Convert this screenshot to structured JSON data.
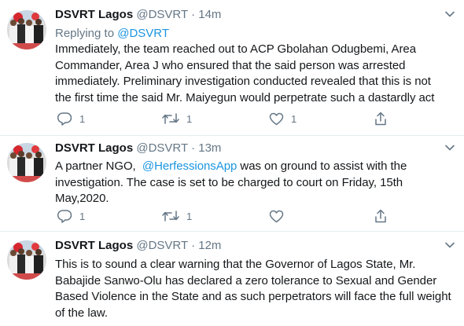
{
  "tweets": [
    {
      "name": "DSVRT Lagos",
      "handle": "@DSVRT",
      "separator": "·",
      "time": "14m",
      "replying_label": "Replying to",
      "replying_handle": "@DSVRT",
      "lines": [
        "Immediately, the team reached out to ACP Gbolahan  Odugbemi, Area",
        "Commander, Area J who ensured that the said person was arrested",
        "immediately. Preliminary investigation conducted revealed  that this is not",
        "the first time the said Mr. Maiyegun would perpetrate such a dastardly act"
      ],
      "reply_count": "1",
      "retweet_count": "1",
      "like_count": "1"
    },
    {
      "name": "DSVRT Lagos",
      "handle": "@DSVRT",
      "separator": "·",
      "time": "13m",
      "line1_prefix": "A partner NGO,  ",
      "line1_mention": "@HerfessionsApp",
      "line1_suffix": " was on ground to assist with the",
      "lines": [
        "investigation.  The case is set to be charged to court on Friday, 15th",
        "May,2020."
      ],
      "reply_count": "1",
      "retweet_count": "1",
      "like_count": ""
    },
    {
      "name": "DSVRT Lagos",
      "handle": "@DSVRT",
      "separator": "·",
      "time": "12m",
      "lines": [
        "This is to sound a clear warning that the Governor of Lagos State, Mr.",
        "Babajide Sanwo-Olu has declared a zero tolerance to Sexual and Gender",
        "Based Violence in the State and as such perpetrators will face the full weight",
        "of the law."
      ]
    }
  ],
  "icons": {
    "reply": "reply-icon",
    "retweet": "retweet-icon",
    "like": "heart-icon",
    "share": "share-icon",
    "caret": "chevron-down-icon"
  },
  "colors": {
    "text": "#14171a",
    "secondary": "#657786",
    "link": "#1b95e0",
    "divider": "#e6ecf0"
  }
}
